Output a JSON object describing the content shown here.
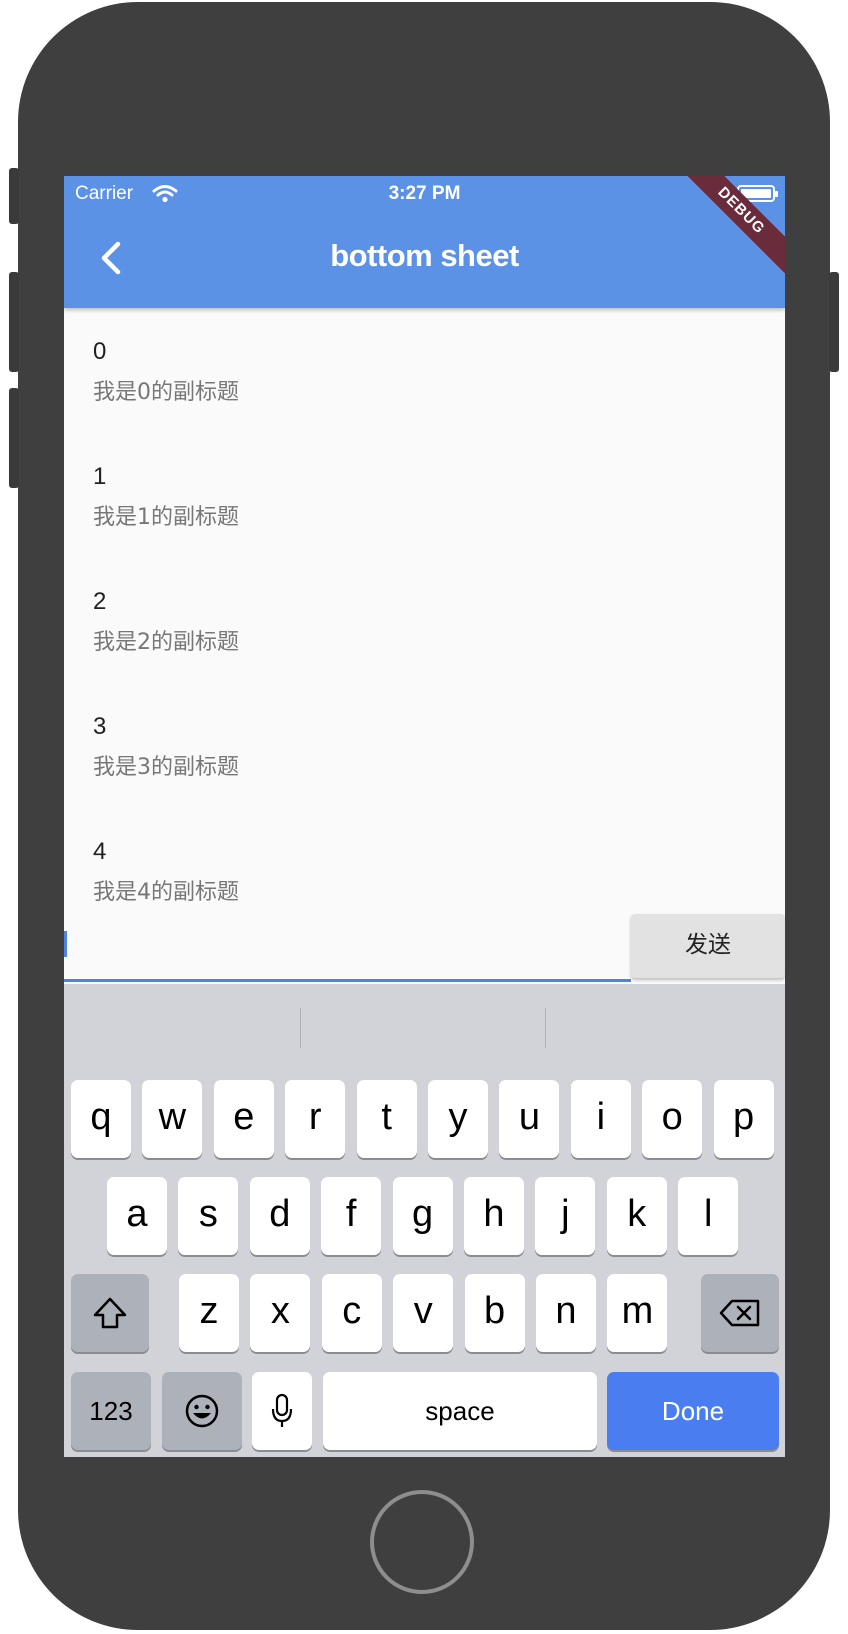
{
  "status_bar": {
    "carrier": "Carrier",
    "time": "3:27 PM"
  },
  "app_bar": {
    "title": "bottom sheet"
  },
  "debug_banner": "DEBUG",
  "list": [
    {
      "title": "0",
      "subtitle": "我是0的副标题"
    },
    {
      "title": "1",
      "subtitle": "我是1的副标题"
    },
    {
      "title": "2",
      "subtitle": "我是2的副标题"
    },
    {
      "title": "3",
      "subtitle": "我是3的副标题"
    },
    {
      "title": "4",
      "subtitle": "我是4的副标题"
    }
  ],
  "input": {
    "value": "",
    "send_label": "发送"
  },
  "keyboard": {
    "row1": [
      "q",
      "w",
      "e",
      "r",
      "t",
      "y",
      "u",
      "i",
      "o",
      "p"
    ],
    "row2": [
      "a",
      "s",
      "d",
      "f",
      "g",
      "h",
      "j",
      "k",
      "l"
    ],
    "row3": [
      "z",
      "x",
      "c",
      "v",
      "b",
      "n",
      "m"
    ],
    "numbers_label": "123",
    "space_label": "space",
    "done_label": "Done"
  },
  "colors": {
    "app_bar": "#5b92e5",
    "accent": "#4a86e0",
    "done_key": "#4a7ef0",
    "debug": "#6a2b3a"
  }
}
